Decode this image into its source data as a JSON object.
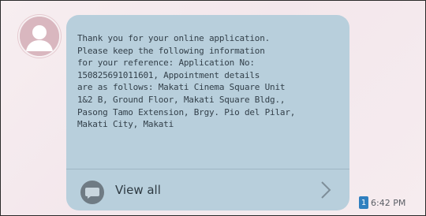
{
  "message": {
    "body": "Thank you for your online application.\nPlease keep the following information\nfor your reference: Application No:\n150825691011601, Appointment details\nare as follows: Makati Cinema Square Unit\n1&2 B, Ground Floor, Makati Square Bldg.,\nPasong Tamo Extension, Brgy.  Pio del Pilar,\nMakati City, Makati",
    "view_all_label": "View all",
    "sim_label": "1",
    "time": "6:42 PM"
  },
  "icons": {
    "avatar": "contact-avatar-icon",
    "view_all": "chat-bubble-icon",
    "chevron": "chevron-right-icon",
    "sim": "sim-card-icon"
  },
  "colors": {
    "bubble": "#b8cfdc",
    "background": "#f5ecef",
    "avatar": "#d9b7bf",
    "sim": "#2f7fbf",
    "text": "#33404a"
  }
}
